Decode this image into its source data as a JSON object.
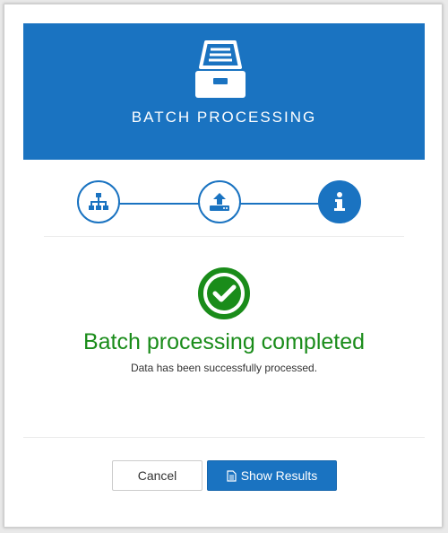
{
  "header": {
    "title": "BATCH PROCESSING",
    "icon": "file-cabinet-icon",
    "background": "#1a73c1"
  },
  "steps": [
    {
      "icon": "sitemap-icon",
      "active": false
    },
    {
      "icon": "upload-icon",
      "active": false
    },
    {
      "icon": "info-icon",
      "active": true
    }
  ],
  "result": {
    "icon": "check-circle-icon",
    "title": "Batch processing completed",
    "subtitle": "Data has been successfully processed.",
    "color": "#1a8c1a"
  },
  "buttons": {
    "cancel_label": "Cancel",
    "show_results_label": "Show Results",
    "show_results_icon": "file-text-icon"
  },
  "colors": {
    "accent": "#1a73c1",
    "success": "#1a8c1a"
  }
}
